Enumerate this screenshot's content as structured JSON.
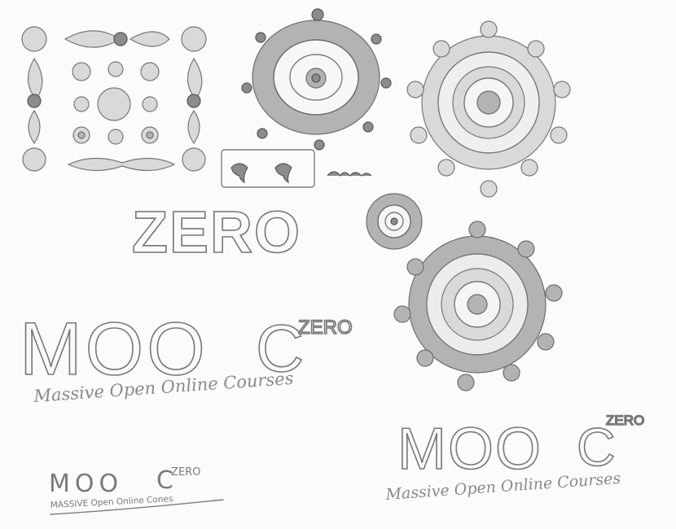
{
  "sketch": {
    "wordmark_large": "ZERO",
    "logo_1": {
      "moo": "MOO",
      "c": "C",
      "zero": "ZERO",
      "tagline": "Massive Open Online Courses"
    },
    "logo_2": {
      "moo": "MOO",
      "c": "C",
      "zero": "ZERO",
      "tagline": "Massive Open Online Courses"
    },
    "logo_3": {
      "moo": "MOO",
      "c": "C",
      "zero": "ZERO",
      "tagline": "MASSIVE Open Online Cones"
    }
  },
  "colors": {
    "paper": "#fbfbfb",
    "graphite": "#7d7d7d"
  }
}
